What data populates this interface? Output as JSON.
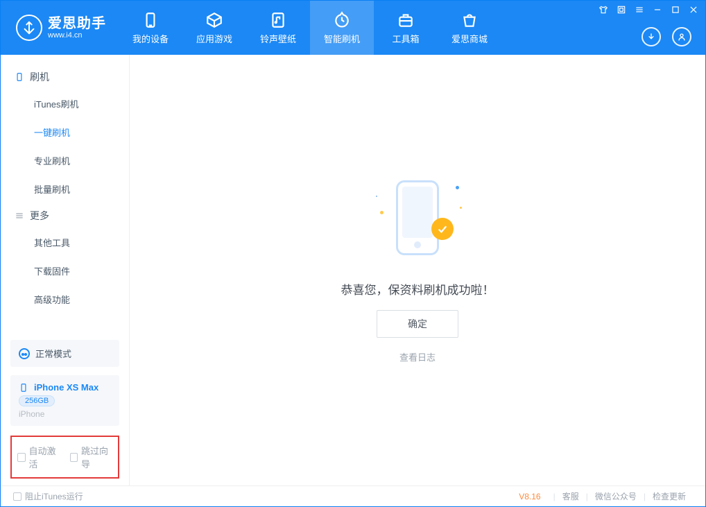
{
  "app": {
    "name": "爱思助手",
    "domain": "www.i4.cn"
  },
  "nav": {
    "items": [
      {
        "label": "我的设备"
      },
      {
        "label": "应用游戏"
      },
      {
        "label": "铃声壁纸"
      },
      {
        "label": "智能刷机"
      },
      {
        "label": "工具箱"
      },
      {
        "label": "爱思商城"
      }
    ],
    "active_index": 3
  },
  "sidebar": {
    "section_flash": {
      "title": "刷机",
      "items": [
        {
          "label": "iTunes刷机"
        },
        {
          "label": "一键刷机"
        },
        {
          "label": "专业刷机"
        },
        {
          "label": "批量刷机"
        }
      ],
      "active_index": 1
    },
    "section_more": {
      "title": "更多",
      "items": [
        {
          "label": "其他工具"
        },
        {
          "label": "下载固件"
        },
        {
          "label": "高级功能"
        }
      ]
    },
    "mode_card": {
      "label": "正常模式"
    },
    "device_card": {
      "name": "iPhone XS Max",
      "storage": "256GB",
      "type": "iPhone"
    },
    "options": {
      "auto_activate": "自动激活",
      "skip_guide": "跳过向导"
    }
  },
  "main": {
    "success_text": "恭喜您，保资料刷机成功啦！",
    "confirm_label": "确定",
    "view_log_label": "查看日志"
  },
  "footer": {
    "block_itunes": "阻止iTunes运行",
    "version": "V8.16",
    "links": {
      "service": "客服",
      "wechat": "微信公众号",
      "update": "检查更新"
    }
  }
}
